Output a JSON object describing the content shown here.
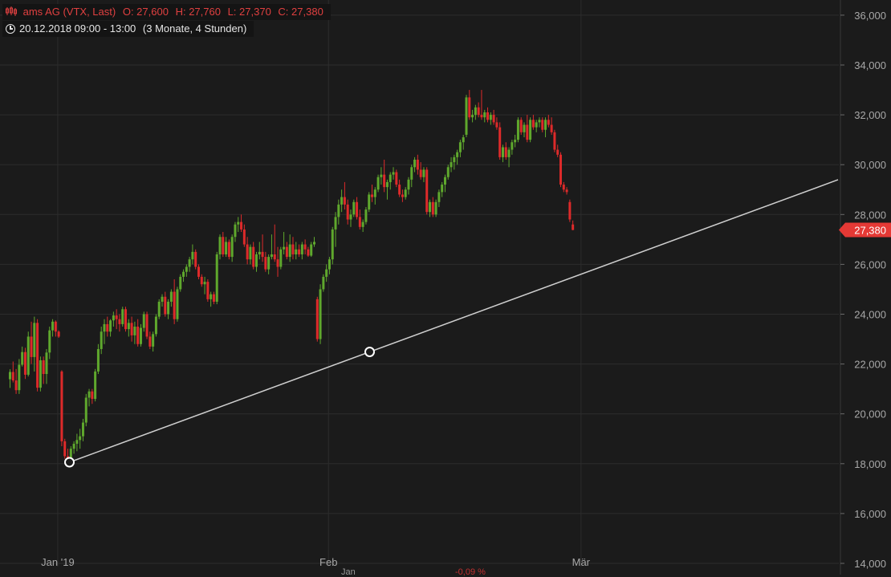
{
  "header": {
    "instrument": "ams AG (VTX, Last)",
    "open": "O: 27,600",
    "high": "H: 27,760",
    "low": "L: 27,370",
    "close": "C: 27,380",
    "period": "20.12.2018 09:00 - 13:00",
    "range": "(3 Monate, 4 Stunden)"
  },
  "colors": {
    "background": "#1b1b1b",
    "grid": "#2c2c2c",
    "up": "#5fa82d",
    "down": "#dd2a2a",
    "trendline": "#cfcfcf",
    "price_tag": "#e53935",
    "axis_text": "#a8a8a8"
  },
  "icons": {
    "chart_type": "candlestick-icon",
    "time": "clock-icon"
  },
  "price_tag": "27,380",
  "chart_data": {
    "type": "candlestick",
    "title": "ams AG (VTX, Last)",
    "ylim": [
      14000,
      36400
    ],
    "y_ticks": [
      14000,
      16000,
      18000,
      20000,
      22000,
      24000,
      26000,
      28000,
      30000,
      32000,
      34000,
      36000
    ],
    "y_tick_labels": [
      "14,000",
      "16,000",
      "18,000",
      "20,000",
      "22,000",
      "24,000",
      "26,000",
      "28,000",
      "30,000",
      "32,000",
      "34,000",
      "36,000"
    ],
    "x_labels": [
      {
        "label": "Jan '19",
        "index": 17
      },
      {
        "label": "Feb",
        "index": 106
      },
      {
        "label": "Mär",
        "index": 189
      }
    ],
    "last_price": 27380,
    "grid": true,
    "candles": [
      [
        21390,
        21790,
        21040,
        21680
      ],
      [
        21680,
        22100,
        21260,
        21340
      ],
      [
        21340,
        21800,
        20800,
        20950
      ],
      [
        20950,
        22200,
        20800,
        21970
      ],
      [
        21970,
        22700,
        21900,
        22480
      ],
      [
        22480,
        22650,
        21400,
        21570
      ],
      [
        21570,
        23300,
        21500,
        23100
      ],
      [
        23100,
        23700,
        22000,
        22280
      ],
      [
        22280,
        23900,
        21700,
        23650
      ],
      [
        23650,
        23800,
        20900,
        21050
      ],
      [
        21050,
        22300,
        20900,
        22150
      ],
      [
        22150,
        22300,
        21200,
        21600
      ],
      [
        21600,
        22600,
        21200,
        22460
      ],
      [
        22460,
        23500,
        22200,
        23350
      ],
      [
        23350,
        23800,
        23100,
        23700
      ],
      [
        23700,
        23750,
        23100,
        23300
      ],
      [
        23300,
        23350,
        23050,
        23100
      ],
      [
        21700,
        21750,
        18700,
        18900
      ],
      [
        18900,
        19000,
        18200,
        18300
      ],
      [
        18300,
        18600,
        18000,
        18100
      ],
      [
        18100,
        18700,
        18000,
        18600
      ],
      [
        18600,
        18900,
        18400,
        18800
      ],
      [
        18800,
        19200,
        18500,
        18950
      ],
      [
        18950,
        19400,
        18600,
        19100
      ],
      [
        19100,
        19800,
        18900,
        19650
      ],
      [
        19650,
        20800,
        19500,
        20650
      ],
      [
        20650,
        21000,
        20300,
        20900
      ],
      [
        20900,
        21000,
        20400,
        20600
      ],
      [
        20600,
        21800,
        20500,
        21700
      ],
      [
        21700,
        22800,
        21600,
        22600
      ],
      [
        22600,
        23500,
        22400,
        23300
      ],
      [
        23300,
        23800,
        22800,
        23600
      ],
      [
        23600,
        23900,
        23100,
        23300
      ],
      [
        23300,
        23800,
        23100,
        23750
      ],
      [
        23750,
        24100,
        23500,
        23950
      ],
      [
        23950,
        24200,
        23400,
        23800
      ],
      [
        23800,
        24000,
        23300,
        23600
      ],
      [
        23600,
        24300,
        23500,
        24200
      ],
      [
        24200,
        24300,
        23300,
        23400
      ],
      [
        23400,
        23800,
        23100,
        23650
      ],
      [
        23650,
        23900,
        22900,
        23150
      ],
      [
        23150,
        23700,
        22800,
        23500
      ],
      [
        23500,
        23800,
        22700,
        22800
      ],
      [
        22800,
        23600,
        22700,
        23450
      ],
      [
        23450,
        24100,
        23300,
        24000
      ],
      [
        24000,
        24100,
        23000,
        23100
      ],
      [
        23100,
        23300,
        22600,
        22700
      ],
      [
        22700,
        23300,
        22500,
        23200
      ],
      [
        23200,
        24000,
        23100,
        23900
      ],
      [
        23900,
        24600,
        23800,
        24500
      ],
      [
        24500,
        24800,
        24300,
        24700
      ],
      [
        24700,
        24900,
        23900,
        24000
      ],
      [
        24000,
        24600,
        23800,
        24500
      ],
      [
        24500,
        25000,
        24300,
        24900
      ],
      [
        24900,
        25400,
        23600,
        23800
      ],
      [
        23800,
        25100,
        23700,
        25000
      ],
      [
        25000,
        25600,
        24900,
        25500
      ],
      [
        25500,
        25800,
        25300,
        25700
      ],
      [
        25700,
        26000,
        25500,
        25900
      ],
      [
        25900,
        26300,
        25700,
        26200
      ],
      [
        26200,
        26800,
        26000,
        26500
      ],
      [
        26500,
        26600,
        25800,
        25900
      ],
      [
        25900,
        26000,
        25400,
        25500
      ],
      [
        25500,
        25600,
        25100,
        25200
      ],
      [
        25200,
        25500,
        24800,
        25300
      ],
      [
        25300,
        25400,
        24500,
        24600
      ],
      [
        24600,
        24900,
        24300,
        24800
      ],
      [
        24800,
        24900,
        24400,
        24500
      ],
      [
        24500,
        26500,
        24400,
        26400
      ],
      [
        26400,
        27200,
        26200,
        27100
      ],
      [
        27100,
        27300,
        26300,
        26400
      ],
      [
        26400,
        27100,
        26300,
        26900
      ],
      [
        26900,
        27000,
        26200,
        26300
      ],
      [
        26300,
        27200,
        26100,
        27100
      ],
      [
        27100,
        27700,
        26900,
        27600
      ],
      [
        27600,
        27900,
        27300,
        27700
      ],
      [
        27700,
        28000,
        27300,
        27400
      ],
      [
        27400,
        27600,
        26700,
        26800
      ],
      [
        26800,
        27100,
        26000,
        26200
      ],
      [
        26200,
        26800,
        26000,
        26700
      ],
      [
        26700,
        26900,
        25800,
        25900
      ],
      [
        25900,
        26500,
        25700,
        26400
      ],
      [
        26400,
        26900,
        26200,
        26500
      ],
      [
        26500,
        27200,
        26100,
        26300
      ],
      [
        26300,
        26500,
        25700,
        25800
      ],
      [
        25800,
        26400,
        25600,
        26300
      ],
      [
        26300,
        27200,
        26200,
        26400
      ],
      [
        26400,
        27600,
        26100,
        26200
      ],
      [
        26200,
        26700,
        25500,
        25900
      ],
      [
        25900,
        26700,
        25800,
        26600
      ],
      [
        26600,
        27300,
        26400,
        26700
      ],
      [
        26700,
        26900,
        26200,
        26300
      ],
      [
        26300,
        27200,
        26100,
        26800
      ],
      [
        26800,
        27100,
        26200,
        26400
      ],
      [
        26400,
        26900,
        26200,
        26600
      ],
      [
        26600,
        26800,
        26300,
        26400
      ],
      [
        26400,
        26900,
        26200,
        26800
      ],
      [
        26800,
        27000,
        26400,
        26600
      ],
      [
        26600,
        26700,
        26300,
        26350
      ],
      [
        26350,
        26900,
        26300,
        26800
      ],
      [
        26800,
        27100,
        26700,
        26900
      ],
      [
        24600,
        24700,
        22900,
        23000
      ],
      [
        23000,
        25200,
        22800,
        25000
      ],
      [
        25000,
        25600,
        24900,
        25500
      ],
      [
        25500,
        26000,
        25300,
        25800
      ],
      [
        25800,
        26300,
        25600,
        26200
      ],
      [
        26200,
        27500,
        26000,
        27400
      ],
      [
        27400,
        28100,
        26700,
        27900
      ],
      [
        27900,
        28600,
        27600,
        28400
      ],
      [
        28400,
        29000,
        28100,
        28700
      ],
      [
        28700,
        29300,
        28200,
        28400
      ],
      [
        28400,
        28600,
        27600,
        27800
      ],
      [
        27800,
        28200,
        27500,
        28000
      ],
      [
        28000,
        28600,
        27900,
        28500
      ],
      [
        28500,
        28700,
        27800,
        27900
      ],
      [
        27900,
        28200,
        27400,
        27500
      ],
      [
        27500,
        27800,
        27300,
        27700
      ],
      [
        27700,
        28300,
        27600,
        28200
      ],
      [
        28200,
        28900,
        28100,
        28800
      ],
      [
        28800,
        29200,
        28500,
        28700
      ],
      [
        28700,
        29100,
        28400,
        29000
      ],
      [
        29000,
        29600,
        28900,
        29500
      ],
      [
        29500,
        29900,
        29200,
        29600
      ],
      [
        29600,
        30200,
        28900,
        29100
      ],
      [
        29100,
        29400,
        28600,
        29300
      ],
      [
        29300,
        29700,
        29000,
        29600
      ],
      [
        29600,
        29900,
        29400,
        29700
      ],
      [
        29700,
        29800,
        29100,
        29200
      ],
      [
        29200,
        29400,
        28700,
        28800
      ],
      [
        28800,
        29000,
        28500,
        28700
      ],
      [
        28700,
        29100,
        28600,
        29000
      ],
      [
        29000,
        29500,
        28800,
        29400
      ],
      [
        29400,
        30000,
        29100,
        29900
      ],
      [
        29900,
        30300,
        29700,
        30200
      ],
      [
        30200,
        30400,
        29600,
        29800
      ],
      [
        29800,
        30100,
        29400,
        29500
      ],
      [
        29500,
        29900,
        29300,
        29800
      ],
      [
        29800,
        29900,
        28000,
        28100
      ],
      [
        28100,
        28600,
        27900,
        28500
      ],
      [
        28500,
        28700,
        27900,
        28000
      ],
      [
        28000,
        28600,
        27900,
        28500
      ],
      [
        28500,
        29000,
        28300,
        28900
      ],
      [
        28900,
        29300,
        28700,
        29200
      ],
      [
        29200,
        29600,
        28900,
        29500
      ],
      [
        29500,
        30000,
        29400,
        29900
      ],
      [
        29900,
        30300,
        29700,
        30100
      ],
      [
        30100,
        30400,
        29800,
        30300
      ],
      [
        30300,
        30600,
        30000,
        30500
      ],
      [
        30500,
        31000,
        30300,
        30900
      ],
      [
        30900,
        31200,
        30600,
        31100
      ],
      [
        31200,
        32800,
        31100,
        32700
      ],
      [
        32700,
        33000,
        31800,
        31900
      ],
      [
        31900,
        32200,
        31700,
        32000
      ],
      [
        32000,
        32400,
        31800,
        32300
      ],
      [
        32300,
        32500,
        31900,
        32000
      ],
      [
        32000,
        33000,
        31800,
        31900
      ],
      [
        31900,
        32200,
        31700,
        32100
      ],
      [
        32100,
        32300,
        31700,
        31800
      ],
      [
        31800,
        32100,
        31600,
        32000
      ],
      [
        32000,
        32200,
        31600,
        31700
      ],
      [
        31700,
        31900,
        31400,
        31500
      ],
      [
        31500,
        31700,
        30200,
        30300
      ],
      [
        30300,
        30800,
        30100,
        30700
      ],
      [
        30700,
        30900,
        30200,
        30300
      ],
      [
        30300,
        30700,
        29900,
        30600
      ],
      [
        30600,
        31000,
        30400,
        30900
      ],
      [
        30900,
        31200,
        30700,
        31000
      ],
      [
        31000,
        31900,
        30900,
        31800
      ],
      [
        31800,
        31900,
        31200,
        31300
      ],
      [
        31300,
        31700,
        31100,
        31600
      ],
      [
        31600,
        32000,
        30900,
        31000
      ],
      [
        31000,
        31900,
        30900,
        31800
      ],
      [
        31800,
        32000,
        31400,
        31500
      ],
      [
        31500,
        31800,
        31300,
        31700
      ],
      [
        31700,
        31900,
        31500,
        31800
      ],
      [
        31800,
        31900,
        31300,
        31400
      ],
      [
        31400,
        31900,
        31100,
        31800
      ],
      [
        31800,
        32000,
        31500,
        31600
      ],
      [
        31600,
        31900,
        31200,
        31300
      ],
      [
        31300,
        31400,
        30500,
        30600
      ],
      [
        30600,
        30800,
        30300,
        30400
      ],
      [
        30400,
        30500,
        29100,
        29200
      ],
      [
        29200,
        29300,
        28900,
        29000
      ],
      [
        29000,
        29100,
        28800,
        28900
      ],
      [
        28500,
        28600,
        27700,
        27800
      ],
      [
        27600,
        27760,
        27370,
        27380
      ]
    ]
  },
  "x_axis_partial": [
    "Jan",
    "-0,09 %"
  ]
}
